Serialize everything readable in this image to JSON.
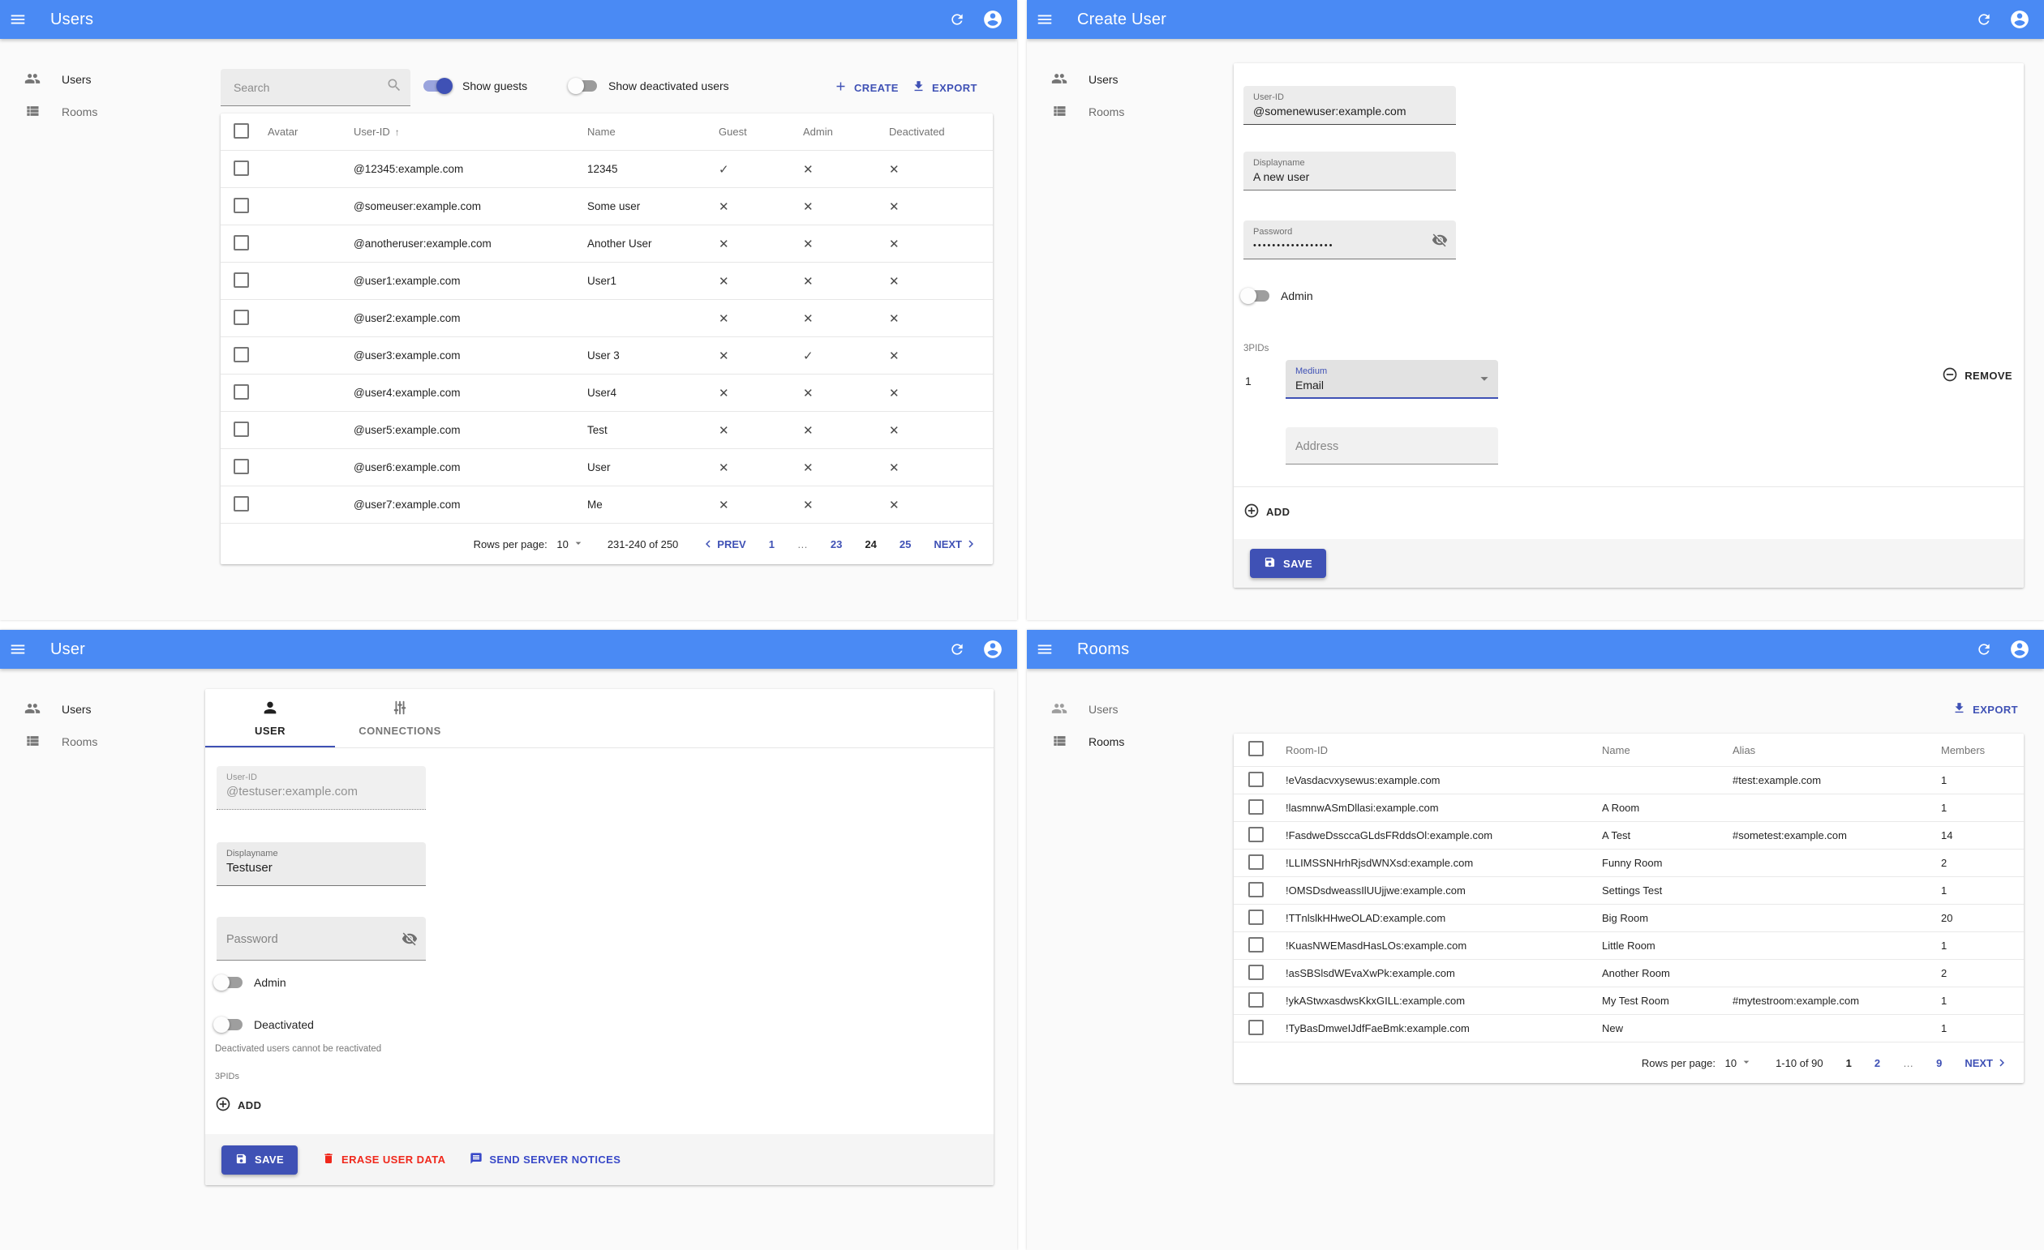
{
  "theme": {
    "appbar_blue": "#4a8af4",
    "primary_indigo": "#3f51b5",
    "link_blue": "#3949c8",
    "danger_red": "#f0281c",
    "content_bg": "#fafafa",
    "card_bg": "#ffffff",
    "divider": "#e7e7e7"
  },
  "icons": {
    "menu": "hamburger",
    "refresh": "circular-arrow",
    "account": "person-in-circle",
    "users": "two-people",
    "rooms": "view-list",
    "search": "magnifier",
    "create_plus": "+",
    "export_download": "down-arrow-tray",
    "sort_arrow": "↑",
    "check": "✓",
    "cross": "✕",
    "prev_chevron": "‹",
    "next_chevron": "›",
    "dropdown_caret": "▾",
    "visibility_off": "eye-slash",
    "remove_circle": "⊖",
    "add_circle": "⊕",
    "save": "floppy-disk",
    "erase": "trash",
    "notices": "speech-bubble",
    "tab_user": "person",
    "tab_connections": "vertical-sliders"
  },
  "sidebar": {
    "users": "Users",
    "rooms": "Rooms"
  },
  "users_panel": {
    "title": "Users",
    "toolbar": {
      "search_placeholder": "Search",
      "show_guests": "Show guests",
      "show_deactivated": "Show deactivated users",
      "create": "CREATE",
      "export": "EXPORT"
    },
    "table": {
      "headers": {
        "avatar": "Avatar",
        "user_id": "User-ID",
        "sort_arrow": "↑",
        "name": "Name",
        "guest": "Guest",
        "admin": "Admin",
        "deactivated": "Deactivated"
      },
      "rows": [
        {
          "user_id": "@12345:example.com",
          "name": "12345",
          "guest": "✓",
          "admin": "✕",
          "deactivated": "✕"
        },
        {
          "user_id": "@someuser:example.com",
          "name": "Some user",
          "guest": "✕",
          "admin": "✕",
          "deactivated": "✕"
        },
        {
          "user_id": "@anotheruser:example.com",
          "name": "Another User",
          "guest": "✕",
          "admin": "✕",
          "deactivated": "✕"
        },
        {
          "user_id": "@user1:example.com",
          "name": "User1",
          "guest": "✕",
          "admin": "✕",
          "deactivated": "✕"
        },
        {
          "user_id": "@user2:example.com",
          "name": "",
          "guest": "✕",
          "admin": "✕",
          "deactivated": "✕"
        },
        {
          "user_id": "@user3:example.com",
          "name": "User 3",
          "guest": "✕",
          "admin": "✓",
          "deactivated": "✕"
        },
        {
          "user_id": "@user4:example.com",
          "name": "User4",
          "guest": "✕",
          "admin": "✕",
          "deactivated": "✕"
        },
        {
          "user_id": "@user5:example.com",
          "name": "Test",
          "guest": "✕",
          "admin": "✕",
          "deactivated": "✕"
        },
        {
          "user_id": "@user6:example.com",
          "name": "User",
          "guest": "✕",
          "admin": "✕",
          "deactivated": "✕"
        },
        {
          "user_id": "@user7:example.com",
          "name": "Me",
          "guest": "✕",
          "admin": "✕",
          "deactivated": "✕"
        }
      ]
    },
    "pagination": {
      "rows_per_page_label": "Rows per page:",
      "rows_per_page": "10",
      "range": "231-240 of 250",
      "prev": "PREV",
      "pages": [
        "1",
        "…",
        "23",
        "24",
        "25"
      ],
      "current_page": "24",
      "next": "NEXT"
    }
  },
  "create_panel": {
    "title": "Create User",
    "form": {
      "user_id_label": "User-ID",
      "user_id_value": "@somenewuser:example.com",
      "displayname_label": "Displayname",
      "displayname_value": "A new user",
      "password_label": "Password",
      "password_value": "•••••••••••••••••",
      "admin_label": "Admin",
      "threepids_label": "3PIDs",
      "row_index": "1",
      "medium_label": "Medium",
      "medium_value": "Email",
      "address_placeholder": "Address",
      "remove": "REMOVE",
      "add": "ADD",
      "save": "SAVE"
    }
  },
  "user_panel": {
    "title": "User",
    "tabs": {
      "user": "USER",
      "connections": "CONNECTIONS"
    },
    "form": {
      "user_id_label": "User-ID",
      "user_id_value": "@testuser:example.com",
      "displayname_label": "Displayname",
      "displayname_value": "Testuser",
      "password_placeholder": "Password",
      "admin_label": "Admin",
      "deactivated_label": "Deactivated",
      "deactivated_helper": "Deactivated users cannot be reactivated",
      "threepids_label": "3PIDs",
      "add": "ADD"
    },
    "footer": {
      "save": "SAVE",
      "erase": "ERASE USER DATA",
      "notices": "SEND SERVER NOTICES"
    }
  },
  "rooms_panel": {
    "title": "Rooms",
    "export": "EXPORT",
    "table": {
      "headers": {
        "room_id": "Room-ID",
        "name": "Name",
        "alias": "Alias",
        "members": "Members"
      },
      "rows": [
        {
          "room_id": "!eVasdacvxysewus:example.com",
          "name": "",
          "alias": "#test:example.com",
          "members": "1"
        },
        {
          "room_id": "!lasmnwASmDllasi:example.com",
          "name": "A Room",
          "alias": "",
          "members": "1"
        },
        {
          "room_id": "!FasdweDssccaGLdsFRddsOl:example.com",
          "name": "A Test",
          "alias": "#sometest:example.com",
          "members": "14"
        },
        {
          "room_id": "!LLIMSSNHrhRjsdWNXsd:example.com",
          "name": "Funny Room",
          "alias": "",
          "members": "2"
        },
        {
          "room_id": "!OMSDsdweassIlUUjjwe:example.com",
          "name": "Settings Test",
          "alias": "",
          "members": "1"
        },
        {
          "room_id": "!TTnlslkHHweOLAD:example.com",
          "name": "Big Room",
          "alias": "",
          "members": "20"
        },
        {
          "room_id": "!KuasNWEMasdHasLOs:example.com",
          "name": "Little Room",
          "alias": "",
          "members": "1"
        },
        {
          "room_id": "!asSBSlsdWEvaXwPk:example.com",
          "name": "Another Room",
          "alias": "",
          "members": "2"
        },
        {
          "room_id": "!ykAStwxasdwsKkxGILL:example.com",
          "name": "My Test Room",
          "alias": "#mytestroom:example.com",
          "members": "1"
        },
        {
          "room_id": "!TyBasDmweIJdfFaeBmk:example.com",
          "name": "New",
          "alias": "",
          "members": "1"
        }
      ]
    },
    "pagination": {
      "rows_per_page_label": "Rows per page:",
      "rows_per_page": "10",
      "range": "1-10 of 90",
      "pages": [
        "1",
        "2",
        "…",
        "9"
      ],
      "current_page": "1",
      "next": "NEXT"
    }
  }
}
